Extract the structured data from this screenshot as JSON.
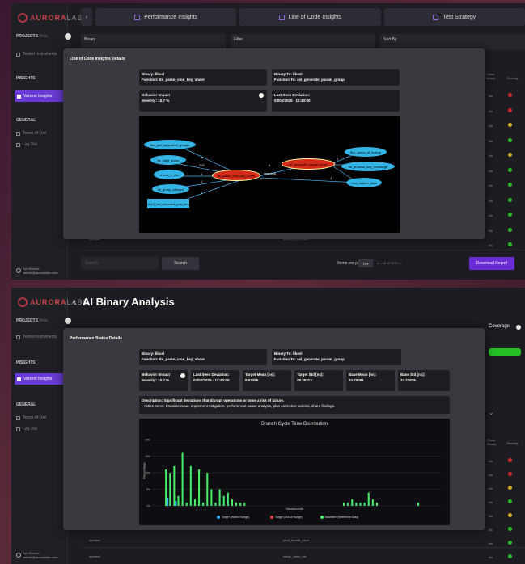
{
  "brand": {
    "name_main": "AURORA",
    "name_suffix": "LABS"
  },
  "sidebar": {
    "projects_label": "PROJECTS",
    "projects_sub": "Beta",
    "tested_instruments": "Tested Instruments",
    "insights_label": "INSIGHTS",
    "version_insights": "Version Insights",
    "general_label": "GENERAL",
    "terms": "Terms of Use",
    "logout": "Log Out",
    "user_name": "Ion Runner",
    "user_email": "admin@auroralabs.com"
  },
  "top": {
    "tabs": [
      "Performance Insights",
      "Line of Code Insights",
      "Test Strategy"
    ],
    "filters": [
      {
        "label": "Binary"
      },
      {
        "label": "Filter"
      },
      {
        "label": "Sort By"
      }
    ],
    "bg_row_left": "openssl",
    "bg_row_mid": "ssl_hfb_pvd_enc0",
    "right_header": [
      "Close Binary",
      "Severity"
    ],
    "right_values": [
      "No",
      "No",
      "No",
      "No",
      "No",
      "No",
      "No",
      "No",
      "No",
      "No",
      "No"
    ],
    "severity_colors": [
      "#d62a2a",
      "#d62a2a",
      "#d6b02a",
      "#2ac02a",
      "#d6b02a",
      "#2ac02a",
      "#2ac02a",
      "#2ac02a",
      "#2ac02a",
      "#2ac02a",
      "#2ac02a"
    ],
    "search_placeholder": "Search",
    "search_button": "Search",
    "items_per_page": "Items per page:",
    "items_per_page_value": "10",
    "page_info": "1 – 10 of 2374",
    "download_button": "Download Report"
  },
  "loc_modal": {
    "title": "Line of Code Insights Details",
    "binary": "Binary: libssl",
    "function": "Function: tls_parse_ctos_key_share",
    "binary_to": "Binary To: libssl",
    "function_to": "Function To: ssl_generate_param_group",
    "impact_label": "Behavior Impact",
    "severity": "Severity: 10.7 %",
    "last_seen_label": "Last Seen Deviation:",
    "last_seen_value": "03/02/2025 - 12:40:00",
    "graph": {
      "nodes_left": [
        "tls1_get_supported_groups",
        "tls_valid_group",
        "check_in_list",
        "tls_group_allowed"
      ],
      "node_rect": "tls13_set_encoded_pub_key",
      "node_center": "tls_parse_ctos_key_share",
      "node_center2": "ssl_generate_param_group",
      "nodes_right": [
        "tls1_group_id_lookup",
        "tls_process_key_exchange",
        "ossl_statem_fatal"
      ],
      "edge_labels": [
        "2",
        "229",
        "9",
        "4",
        "1",
        "4",
        "6",
        "1",
        "selected",
        "1",
        "1"
      ]
    }
  },
  "bottom": {
    "page_title": "AI Binary Analysis",
    "coverage_label": "Coverage",
    "right_header": [
      "Close Binary",
      "Severity"
    ],
    "row1_left": "openssl",
    "row1_mid": "print_format_error",
    "row2_left": "openssl",
    "row2_mid": "setup_client_ctx",
    "right_values": [
      "No",
      "No",
      "No",
      "No",
      "No",
      "No",
      "No",
      "No"
    ],
    "severity_colors": [
      "#d62a2a",
      "#d62a2a",
      "#d6b02a",
      "#2ac02a",
      "#d6b02a",
      "#2ac02a",
      "#2ac02a",
      "#2ac02a"
    ]
  },
  "perf_modal": {
    "title": "Performance Status Details",
    "binary": "Binary: libssl",
    "function": "Function: tls_parse_ctos_key_share",
    "binary_to": "Binary To: libssl",
    "function_to": "Function To: ssl_generate_param_group",
    "impact_label": "Behavior Impact",
    "severity": "Severity: 10.7 %",
    "last_seen_label": "Last Seen Deviation:",
    "last_seen_value": "03/02/2025 - 12:40:00",
    "target_mean_label": "Target Mean [ns]:",
    "target_mean_value": "9.57386",
    "target_std_label": "Target Std [ns]:",
    "target_std_value": "28.35313",
    "base_mean_label": "Base Mean [ns]:",
    "base_mean_value": "34.70091",
    "base_std_label": "Base Std [ns]:",
    "base_std_value": "74.22629",
    "description": "Description: Significant deviations that disrupt operations or pose a risk of failure.",
    "action": "• Action items: Escalate issue, implement mitigation, perform root cause analysis, plan corrective actions, share findings."
  },
  "chart_data": {
    "type": "bar",
    "title": "Branch Cycle Time Distribution",
    "xlabel": "Nanoseconds",
    "ylabel": "Percentage",
    "ytick_labels": [
      "0%",
      "5%",
      "10%",
      "15%",
      "20%"
    ],
    "ylim": [
      0,
      22
    ],
    "series": [
      {
        "name": "Target (Within Range)",
        "color": "#33aaff",
        "values": [
          0,
          0,
          0,
          2.5,
          0,
          1.5,
          0,
          0,
          0,
          0,
          0,
          0,
          0,
          0,
          0,
          0,
          0,
          0,
          0,
          0,
          0,
          0,
          0,
          0,
          0,
          0,
          0,
          0,
          0,
          0,
          0,
          0,
          0,
          0,
          0,
          0,
          0,
          0,
          0,
          0,
          0,
          0,
          0,
          0,
          0,
          0,
          0,
          0,
          0,
          0,
          0,
          0,
          0,
          0,
          0,
          0,
          0,
          0,
          0,
          0,
          0,
          0,
          0,
          0,
          0,
          0,
          0,
          0,
          0,
          0
        ]
      },
      {
        "name": "Target (Out of Range)",
        "color": "#ee3333",
        "values": []
      },
      {
        "name": "Baseline (Reference Data)",
        "color": "#44ee66",
        "values": [
          0,
          0,
          0,
          11,
          10,
          12,
          3,
          16,
          1,
          12,
          2,
          11,
          1,
          10,
          5,
          1,
          5,
          3,
          4,
          2,
          1,
          1,
          1,
          0,
          0,
          0,
          0,
          0,
          0,
          0,
          0,
          0,
          0,
          0,
          0,
          0,
          0,
          0,
          0,
          0,
          0,
          0,
          0,
          0,
          0,
          0,
          1,
          1,
          2,
          1,
          1,
          1,
          4,
          2,
          1,
          0,
          0,
          0,
          0,
          0,
          0,
          0,
          0,
          0,
          1,
          0,
          0,
          0,
          0,
          0
        ]
      }
    ],
    "legend_position": "bottom"
  }
}
